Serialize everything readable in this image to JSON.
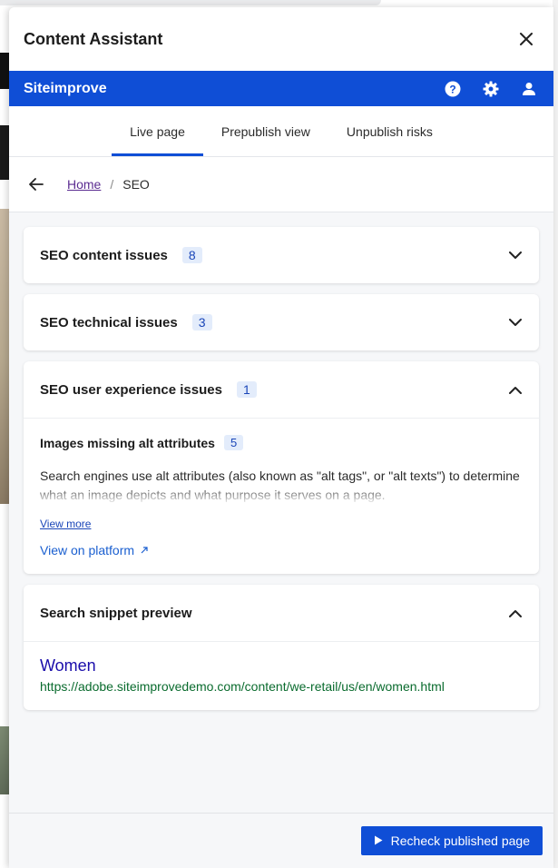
{
  "panel": {
    "title": "Content Assistant"
  },
  "brand": {
    "name": "Siteimprove"
  },
  "tabs": [
    {
      "label": "Live page"
    },
    {
      "label": "Prepublish view"
    },
    {
      "label": "Unpublish risks"
    }
  ],
  "breadcrumb": {
    "home": "Home",
    "separator": "/",
    "current": "SEO"
  },
  "sections": [
    {
      "title": "SEO content issues",
      "count": "8"
    },
    {
      "title": "SEO technical issues",
      "count": "3"
    },
    {
      "title": "SEO user experience issues",
      "count": "1"
    }
  ],
  "ux_issue": {
    "title": "Images missing alt attributes",
    "count": "5",
    "description": "Search engines use alt attributes (also known as \"alt tags\", or \"alt texts\") to determine what an image depicts and what purpose it serves on a page.",
    "view_more": "View more",
    "view_platform": "View on platform"
  },
  "snippet": {
    "section_title": "Search snippet preview",
    "title": "Women",
    "url": "https://adobe.siteimprovedemo.com/content/we-retail/us/en/women.html"
  },
  "footer": {
    "recheck_label": "Recheck published page"
  },
  "colors": {
    "brand_blue": "#0f4ed6",
    "link_purple": "#5b2c91",
    "snippet_link": "#1a0dab",
    "snippet_url": "#0a6b2e"
  },
  "icons": [
    "close-icon",
    "help-icon",
    "gear-icon",
    "user-icon",
    "back-arrow-icon",
    "chevron-down-icon",
    "chevron-up-icon",
    "external-link-icon",
    "play-icon"
  ]
}
